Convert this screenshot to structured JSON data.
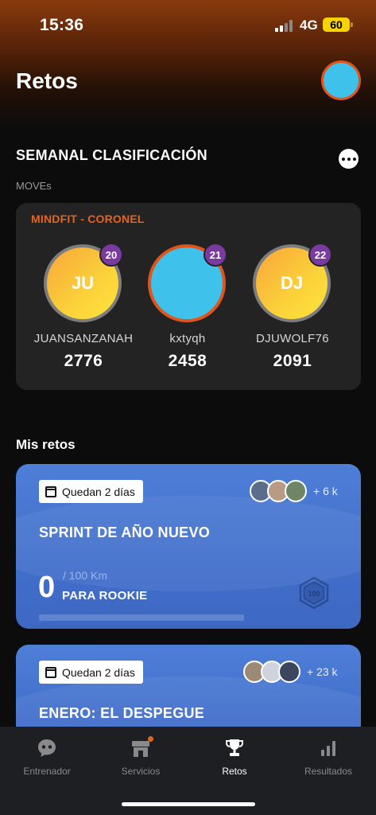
{
  "status_bar": {
    "time": "15:36",
    "network": "4G",
    "battery": "60"
  },
  "header": {
    "title": "Retos"
  },
  "leaderboard": {
    "title": "SEMANAL CLASIFICACIÓN",
    "metric": "MOVEs",
    "group": "MINDFIT - CORONEL",
    "entries": [
      {
        "initials": "JU",
        "rank": "20",
        "name": "JUANSANZANAH",
        "score": "2776"
      },
      {
        "initials": "",
        "rank": "21",
        "name": "kxtyqh",
        "score": "2458"
      },
      {
        "initials": "DJ",
        "rank": "22",
        "name": "DJUWOLF76",
        "score": "2091"
      }
    ]
  },
  "my_challenges": {
    "title": "Mis retos",
    "cards": [
      {
        "time_left": "Quedan 2 días",
        "participants_more": "+ 6 k",
        "title": "SPRINT DE AÑO NUEVO",
        "progress_value": "0",
        "progress_target": "/ 100 Km",
        "level": "PARA ROOKIE",
        "progress_fraction": 0,
        "badge_icon": "hexagon-100-badge-icon"
      },
      {
        "time_left": "Quedan 2 días",
        "participants_more": "+ 23 k",
        "title": "ENERO: EL DESPEGUE"
      }
    ]
  },
  "tabs": [
    {
      "label": "Entrenador",
      "icon": "coach-chat-icon"
    },
    {
      "label": "Servicios",
      "icon": "store-icon"
    },
    {
      "label": "Retos",
      "icon": "trophy-icon"
    },
    {
      "label": "Resultados",
      "icon": "bar-chart-icon"
    }
  ],
  "colors": {
    "accent": "#e5631f",
    "card_blue": "#4270cc",
    "rank_purple": "#7b3aa0",
    "avatar_blue": "#3ec1ea"
  }
}
